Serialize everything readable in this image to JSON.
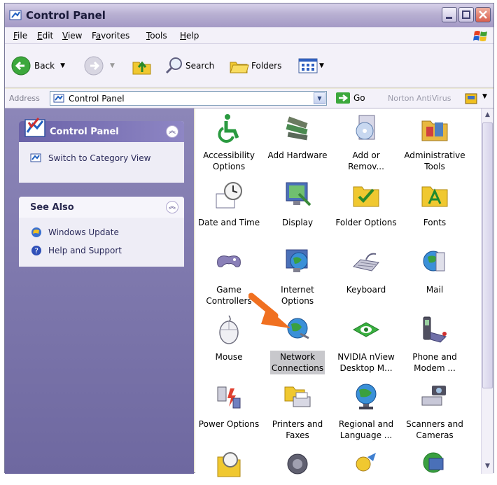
{
  "window": {
    "title": "Control Panel"
  },
  "menu": [
    {
      "mn": "F",
      "rest": "ile"
    },
    {
      "mn": "E",
      "rest": "dit"
    },
    {
      "mn": "V",
      "rest": "iew"
    },
    {
      "pre": "F",
      "mn": "a",
      "rest": "vorites"
    },
    {
      "mn": "T",
      "rest": "ools"
    },
    {
      "mn": "H",
      "rest": "elp"
    }
  ],
  "toolbar": {
    "back": "Back",
    "search": "Search",
    "folders": "Folders"
  },
  "address": {
    "label": "Address",
    "value": "Control Panel",
    "go": "Go",
    "norton": "Norton AntiVirus"
  },
  "sidebar": {
    "cp_title": "Control Panel",
    "switch_view": "Switch to Category View",
    "see_also_title": "See Also",
    "links": [
      "Windows Update",
      "Help and Support"
    ]
  },
  "items": [
    {
      "l1": "Accessibility",
      "l2": "Options",
      "icon": "accessibility-icon"
    },
    {
      "l1": "Add Hardware",
      "l2": "",
      "icon": "add-hardware-icon"
    },
    {
      "l1": "Add or",
      "l2": "Remov...",
      "icon": "add-remove-programs-icon"
    },
    {
      "l1": "Administrative",
      "l2": "Tools",
      "icon": "administrative-tools-icon"
    },
    {
      "l1": "Date and Time",
      "l2": "",
      "icon": "date-time-icon"
    },
    {
      "l1": "Display",
      "l2": "",
      "icon": "display-icon"
    },
    {
      "l1": "Folder Options",
      "l2": "",
      "icon": "folder-options-icon"
    },
    {
      "l1": "Fonts",
      "l2": "",
      "icon": "fonts-icon"
    },
    {
      "l1": "Game",
      "l2": "Controllers",
      "icon": "game-controllers-icon"
    },
    {
      "l1": "Internet",
      "l2": "Options",
      "icon": "internet-options-icon"
    },
    {
      "l1": "Keyboard",
      "l2": "",
      "icon": "keyboard-icon"
    },
    {
      "l1": "Mail",
      "l2": "",
      "icon": "mail-icon"
    },
    {
      "l1": "Mouse",
      "l2": "",
      "icon": "mouse-icon"
    },
    {
      "l1": "Network",
      "l2": "Connections",
      "icon": "network-connections-icon",
      "selected": true
    },
    {
      "l1": "NVIDIA nView",
      "l2": "Desktop M...",
      "icon": "nvidia-icon"
    },
    {
      "l1": "Phone and",
      "l2": "Modem ...",
      "icon": "phone-modem-icon"
    },
    {
      "l1": "Power Options",
      "l2": "",
      "icon": "power-options-icon"
    },
    {
      "l1": "Printers and",
      "l2": "Faxes",
      "icon": "printers-faxes-icon"
    },
    {
      "l1": "Regional and",
      "l2": "Language ...",
      "icon": "regional-language-icon"
    },
    {
      "l1": "Scanners and",
      "l2": "Cameras",
      "icon": "scanners-cameras-icon"
    },
    {
      "l1": "",
      "l2": "",
      "icon": "scheduled-tasks-icon"
    },
    {
      "l1": "",
      "l2": "",
      "icon": "sounds-icon"
    },
    {
      "l1": "",
      "l2": "",
      "icon": "speech-icon"
    },
    {
      "l1": "",
      "l2": "",
      "icon": "system-icon"
    }
  ],
  "colors": {
    "accent_arrow": "#f07020",
    "sidebar": "#7a74a8",
    "selection": "#c8c8cc"
  }
}
